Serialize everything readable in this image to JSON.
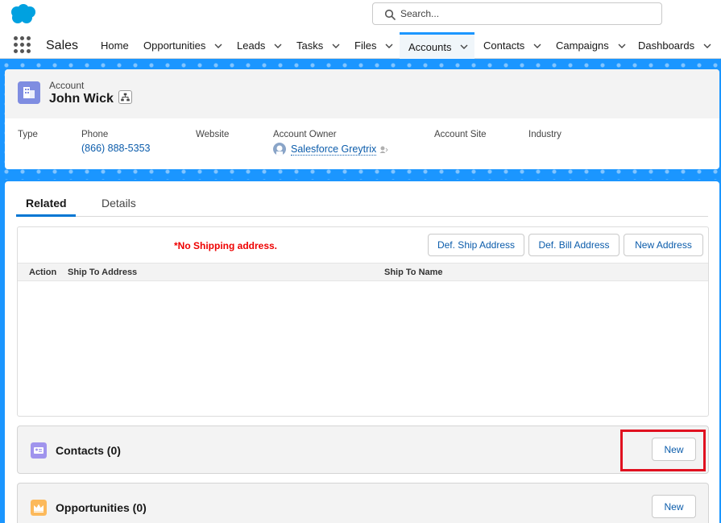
{
  "global": {
    "search_placeholder": "Search..."
  },
  "nav": {
    "app_name": "Sales",
    "items": [
      {
        "label": "Home",
        "dropdown": false
      },
      {
        "label": "Opportunities",
        "dropdown": true
      },
      {
        "label": "Leads",
        "dropdown": true
      },
      {
        "label": "Tasks",
        "dropdown": true
      },
      {
        "label": "Files",
        "dropdown": true
      },
      {
        "label": "Accounts",
        "dropdown": true,
        "active": true
      },
      {
        "label": "Contacts",
        "dropdown": true
      },
      {
        "label": "Campaigns",
        "dropdown": true
      },
      {
        "label": "Dashboards",
        "dropdown": true
      }
    ]
  },
  "record": {
    "entity_label": "Account",
    "name": "John Wick",
    "fields": {
      "type_label": "Type",
      "type_value": "",
      "phone_label": "Phone",
      "phone_value": "(866) 888-5353",
      "website_label": "Website",
      "website_value": "",
      "owner_label": "Account Owner",
      "owner_value": "Salesforce Greytrix",
      "site_label": "Account Site",
      "site_value": "",
      "industry_label": "Industry",
      "industry_value": ""
    }
  },
  "tabs": {
    "related": "Related",
    "details": "Details"
  },
  "addresses": {
    "warning": "*No Shipping address.",
    "btn_ship": "Def. Ship Address",
    "btn_bill": "Def. Bill Address",
    "btn_new": "New Address",
    "col_action": "Action",
    "col_ship_to_address": "Ship To Address",
    "col_ship_to_name": "Ship To Name"
  },
  "related_lists": {
    "contacts_title": "Contacts (0)",
    "contacts_new": "New",
    "opportunities_title": "Opportunities (0)",
    "opportunities_new": "New"
  },
  "colors": {
    "brand_blue": "#1b96ff",
    "account_icon": "#7f8de1",
    "contacts_icon": "#a094ed",
    "opportunities_icon": "#fcb95b",
    "warning_red": "#e00000",
    "highlight_box": "#e0101f",
    "link": "#0b5cab"
  },
  "icons": {
    "logo": "salesforce-cloud-logo",
    "search": "search-icon",
    "waffle": "app-launcher-icon",
    "account": "account-icon",
    "hierarchy": "hierarchy-icon",
    "contacts": "contact-card-icon",
    "opportunities": "crown-icon"
  }
}
